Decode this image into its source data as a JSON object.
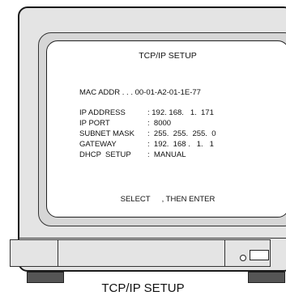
{
  "osd": {
    "title": "TCP/IP SETUP",
    "mac_line": "MAC ADDR . . . 00-01-A2-01-1E-77",
    "fields": [
      {
        "label": "IP ADDRESS",
        "value": ": 192. 168.   1.  171"
      },
      {
        "label": "IP PORT",
        "value": ":  8000"
      },
      {
        "label": "SUBNET MASK",
        "value": ":  255.  255.  255.  0"
      },
      {
        "label": "GATEWAY",
        "value": ":  192.  168 .   1.   1"
      },
      {
        "label": "DHCP  SETUP",
        "value": ":  MANUAL"
      }
    ],
    "hint_select": "SELECT",
    "hint_enter": ", THEN ENTER"
  },
  "caption": "TCP/IP SETUP"
}
